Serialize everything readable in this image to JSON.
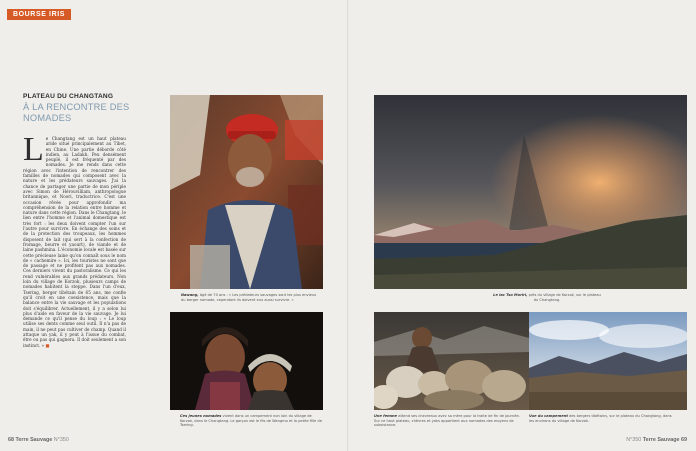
{
  "section_badge": "BOURSE IRIS",
  "kicker": "PLATEAU DU CHANGTANG",
  "headline": "À LA RENCONTRE DES NOMADES",
  "article": {
    "dropcap": "L",
    "body": "e Changtang est un haut plateau aride situé principalement au Tibet, en Chine. Une partie déborde côté indien, au Ladakh. Peu densément peuplé, il est fréquenté par des nomades. Je me rends dans cette région avec l'intention de rencontrer des familles de nomades qui composent avec la nature et les prédateurs sauvages. J'ai la chance de partager une partie de mon périple avec Simon de Hérouvilliam, anthropologue britannique, et Noori, traductrice. C'est une occasion rêvée pour approfondir ma compréhension de la relation entre homme et nature dans cette région. Dans le Changtang, le lien entre l'homme et l'animal domestique est très fort : les deux doivent compter l'un sur l'autre pour survivre. En échange des soins et de la protection des troupeaux, les hommes disposent de lait (qui sert à la confection de fromage, beurre et yaourt), de viande et de laine pashmina. L'économie locale est basée sur cette précieuse laine qu'on connaît sous le nom de « cachemire ». Ici, les touristes ne sont que de passage et ne profitent pas aux nomades. Ces derniers vivent du pastoralisme. Ce qui les rend vulnérables aux grands prédateurs. Non loin du village de Korzok, plusieurs camps de nomades habitent la steppe. Dans l'un d'eux, Tsering, berger tibétain de 65 ans, me confie qu'il croit en une coexistence, mais que la balance entre la vie sauvage et les populations doit s'équilibrer. Actuellement, il y a selon lui plus d'aide en faveur de la vie sauvage. Je lui demande ce qu'il pense du loup : « Le loup utilise ses dents comme seul outil. Il n'a pas de main, il ne peut pas cultiver de champ. Quand il attaque un yak, il y peut à l'issue du combat, être ou pas qui gagnera. Il doit seulement a son instinct. »",
    "endmark": "■"
  },
  "captions": {
    "nawang": {
      "name": "Nawang,",
      "text": " âgé de 70 ans : « Les prédateurs sauvages sont les plus envieux du berger nomade, cependant ils doivent eux aussi survivre. »"
    },
    "lake": {
      "name": "Le lac Tso Moriri,",
      "text": " près du village de Korzok, sur le plateau du Changtang."
    },
    "children": {
      "name": "Ces jeunes nomades",
      "text": " vivent dans un campement non loin du village de Korzok, dans le Changtang. Le garçon est le fils de Wangmo et la petite fille de Tsering."
    },
    "woman": {
      "name": "Une femme",
      "text": " attend ses chevreaux avec sa mère pour la traite de fin de journée. Sur ce haut plateau, chèvres et yaks appartient aux nomades des moyens de subsistance."
    },
    "camp": {
      "name": "Vue du campement",
      "text": " des bergers tibétains, sur le plateau du Changtang, dans les environs du village de Korzok."
    }
  },
  "folio": {
    "left_number": "68",
    "left_magazine": "Terre Sauvage",
    "left_issue": "N°350",
    "right_issue": "N°350",
    "right_magazine": "Terre Sauvage",
    "right_number": "69"
  },
  "colors": {
    "accent": "#d65a25",
    "headline": "#7f9ab0",
    "paper": "#efeeea"
  },
  "photos": [
    "portrait-nawang",
    "storm-over-lake-tso-moriri",
    "young-nomad-children",
    "woman-with-goats",
    "nomad-camp-valley"
  ]
}
